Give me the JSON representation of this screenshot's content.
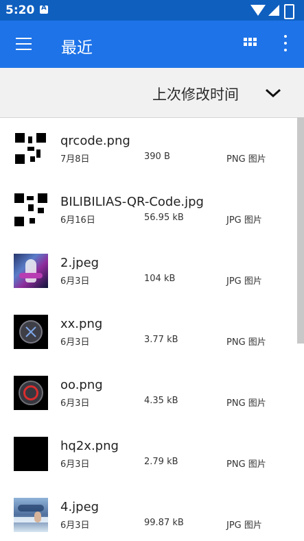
{
  "status_bar": {
    "time": "5:20"
  },
  "app_bar": {
    "title": "最近"
  },
  "sort_bar": {
    "label": "上次修改时间"
  },
  "files": [
    {
      "name": "qrcode.png",
      "date": "7月8日",
      "size": "390 B",
      "type": "PNG 图片",
      "thumb": "qr-code-image"
    },
    {
      "name": "BILIBILIAS-QR-Code.jpg",
      "date": "6月16日",
      "size": "56.95 kB",
      "type": "JPG 图片",
      "thumb": "qr-code-image"
    },
    {
      "name": "2.jpeg",
      "date": "6月3日",
      "size": "104 kB",
      "type": "JPG 图片",
      "thumb": "anime-art-image"
    },
    {
      "name": "xx.png",
      "date": "6月3日",
      "size": "3.77 kB",
      "type": "PNG 图片",
      "thumb": "x-button-image"
    },
    {
      "name": "oo.png",
      "date": "6月3日",
      "size": "4.35 kB",
      "type": "PNG 图片",
      "thumb": "circle-button-image"
    },
    {
      "name": "hq2x.png",
      "date": "6月3日",
      "size": "2.79 kB",
      "type": "PNG 图片",
      "thumb": "black-image"
    },
    {
      "name": "4.jpeg",
      "date": "6月3日",
      "size": "99.87 kB",
      "type": "JPG 图片",
      "thumb": "sea-art-image"
    }
  ]
}
